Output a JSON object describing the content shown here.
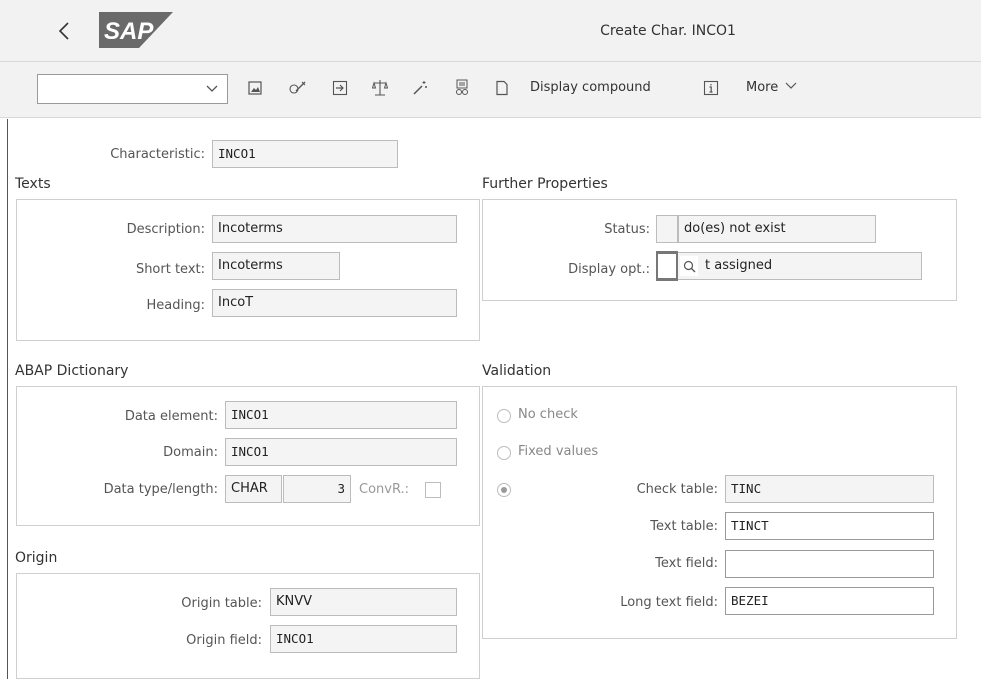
{
  "header": {
    "title": "Create Char. INCO1",
    "logo_text": "SAP"
  },
  "toolbar": {
    "select_value": "",
    "display_compound_label": "Display compound",
    "more_label": "More",
    "icons": [
      "image-icon",
      "edit-icon",
      "export-icon",
      "scales-icon",
      "magic-wand-icon",
      "documents-icon",
      "page-icon",
      "info-icon"
    ]
  },
  "characteristic": {
    "label": "Characteristic:",
    "value": "INCO1"
  },
  "texts": {
    "title": "Texts",
    "description_label": "Description:",
    "description_value": "Incoterms",
    "short_text_label": "Short text:",
    "short_text_value": "Incoterms",
    "heading_label": "Heading:",
    "heading_value": "IncoT"
  },
  "further_properties": {
    "title": "Further Properties",
    "status_label": "Status:",
    "status_value": "do(es) not exist",
    "display_opt_label": "Display opt.:",
    "display_opt_value": "t assigned"
  },
  "abap_dictionary": {
    "title": "ABAP Dictionary",
    "data_element_label": "Data element:",
    "data_element_value": "INCO1",
    "domain_label": "Domain:",
    "domain_value": "INCO1",
    "data_type_label": "Data type/length:",
    "data_type_value": "CHAR",
    "length_value": "3",
    "convr_label": "ConvR.:"
  },
  "origin": {
    "title": "Origin",
    "origin_table_label": "Origin table:",
    "origin_table_value": "KNVV",
    "origin_field_label": "Origin field:",
    "origin_field_value": "INCO1"
  },
  "validation": {
    "title": "Validation",
    "no_check_label": "No check",
    "fixed_values_label": "Fixed values",
    "check_table_label": "Check table:",
    "check_table_value": "TINC",
    "text_table_label": "Text table:",
    "text_table_value": "TINCT",
    "text_field_label": "Text field:",
    "text_field_value": "",
    "long_text_field_label": "Long text field:",
    "long_text_field_value": "BEZEI"
  }
}
